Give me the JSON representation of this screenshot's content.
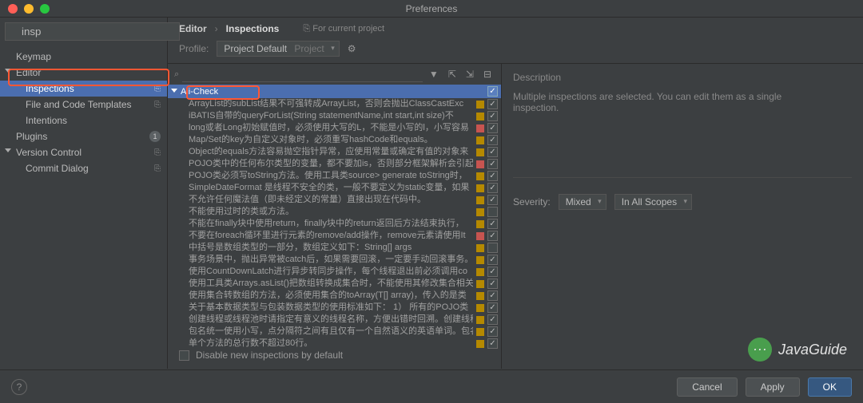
{
  "window": {
    "title": "Preferences"
  },
  "search": {
    "value": "insp"
  },
  "sidebar": {
    "items": [
      {
        "label": "Keymap",
        "indent": 0,
        "expandable": false
      },
      {
        "label": "Editor",
        "indent": 0,
        "expandable": true
      },
      {
        "label": "Inspections",
        "indent": 1,
        "expandable": false,
        "selected": true,
        "cp": true
      },
      {
        "label": "File and Code Templates",
        "indent": 1,
        "expandable": false,
        "cp": true
      },
      {
        "label": "Intentions",
        "indent": 1,
        "expandable": false
      },
      {
        "label": "Plugins",
        "indent": 0,
        "expandable": false,
        "badge": "1"
      },
      {
        "label": "Version Control",
        "indent": 0,
        "expandable": true,
        "cp": true
      },
      {
        "label": "Commit Dialog",
        "indent": 1,
        "expandable": false,
        "cp": true
      }
    ]
  },
  "breadcrumb": {
    "root": "Editor",
    "current": "Inspections",
    "scope": "For current project"
  },
  "profile": {
    "label": "Profile:",
    "name": "Project Default",
    "scope": "Project"
  },
  "inspections": {
    "group": "Ali-Check",
    "group_checked": true,
    "rows": [
      {
        "label": "ArrayList的subList结果不可强转成ArrayList，否则会抛出ClassCastExc",
        "sev": "w",
        "checked": true
      },
      {
        "label": "iBATIS自带的queryForList(String statementName,int start,int size)不",
        "sev": "w",
        "checked": true
      },
      {
        "label": "long或者Long初始赋值时，必须使用大写的L，不能是小写的l，小写容易",
        "sev": "e",
        "checked": true
      },
      {
        "label": "Map/Set的key为自定义对象时，必须重写hashCode和equals。",
        "sev": "w",
        "checked": true
      },
      {
        "label": "Object的equals方法容易抛空指针异常，应使用常量或确定有值的对象来",
        "sev": "w",
        "checked": true
      },
      {
        "label": "POJO类中的任何布尔类型的变量，都不要加is，否则部分框架解析会引起",
        "sev": "e",
        "checked": true
      },
      {
        "label": "POJO类必须写toString方法。使用工具类source> generate toString时，",
        "sev": "w",
        "checked": true
      },
      {
        "label": "SimpleDateFormat 是线程不安全的类，一般不要定义为static变量，如果",
        "sev": "w",
        "checked": true
      },
      {
        "label": "不允许任何魔法值（即未经定义的常量）直接出现在代码中。",
        "sev": "w",
        "checked": true
      },
      {
        "label": "不能使用过时的类或方法。",
        "sev": "w",
        "checked": false
      },
      {
        "label": "不能在finally块中使用return，finally块中的return返回后方法结束执行，",
        "sev": "w",
        "checked": true
      },
      {
        "label": "不要在foreach循环里进行元素的remove/add操作，remove元素请使用It",
        "sev": "e",
        "checked": true
      },
      {
        "label": "中括号是数组类型的一部分，数组定义如下：String[] args",
        "sev": "w",
        "checked": false
      },
      {
        "label": "事务场景中，抛出异常被catch后，如果需要回滚，一定要手动回滚事务。",
        "sev": "w",
        "checked": true
      },
      {
        "label": "使用CountDownLatch进行异步转同步操作，每个线程退出前必须调用co",
        "sev": "w",
        "checked": true
      },
      {
        "label": "使用工具类Arrays.asList()把数组转换成集合时，不能使用其修改集合相关",
        "sev": "w",
        "checked": true
      },
      {
        "label": "使用集合转数组的方法，必须使用集合的toArray(T[] array)，传入的是类",
        "sev": "w",
        "checked": true
      },
      {
        "label": "关于基本数据类型与包装数据类型的使用标准如下：  1） 所有的POJO类",
        "sev": "w",
        "checked": true
      },
      {
        "label": "创建线程或线程池时请指定有意义的线程名称，方便出错时回溯。创建线程",
        "sev": "w",
        "checked": true
      },
      {
        "label": "包名统一使用小写，点分隔符之间有且仅有一个自然语义的英语单词。包名",
        "sev": "w",
        "checked": true
      },
      {
        "label": "单个方法的总行数不超过80行。",
        "sev": "w",
        "checked": true
      }
    ]
  },
  "desc": {
    "header": "Description",
    "text": "Multiple inspections are selected. You can edit them as a single inspection.",
    "severity_label": "Severity:",
    "severity_value": "Mixed",
    "scope_value": "In All Scopes"
  },
  "footer": {
    "disable_label": "Disable new inspections by default",
    "help": "?",
    "cancel": "Cancel",
    "apply": "Apply",
    "ok": "OK"
  },
  "watermark": {
    "text": "JavaGuide"
  }
}
